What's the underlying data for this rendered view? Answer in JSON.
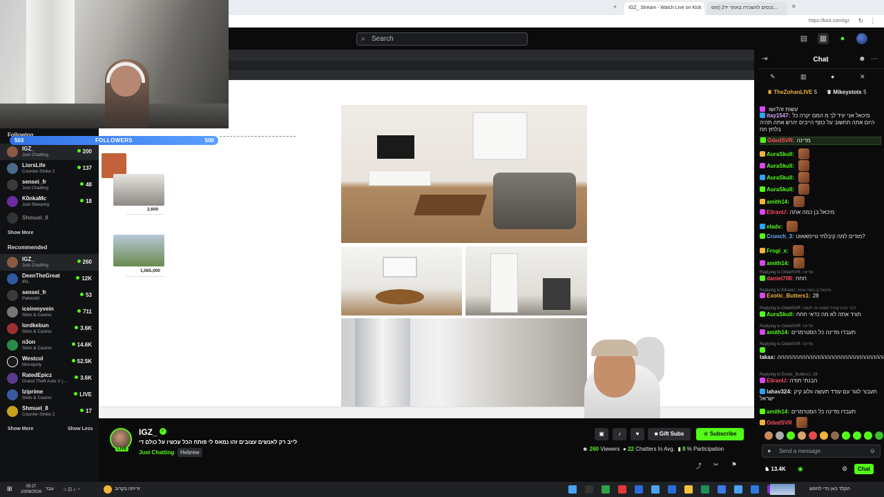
{
  "browser": {
    "tabs": [
      "IGZ_ Stream - Watch Live on Kick",
      "נכסים להשכרה באתר יד2 (פוס..."
    ],
    "url": "https://kick.com/igz"
  },
  "topnav": {
    "search_placeholder": "Search"
  },
  "followers_bar": {
    "left": "503",
    "label": "FOLLOWERS",
    "right": "500"
  },
  "sidebar": {
    "following_label": "Following",
    "following": [
      {
        "name": "IGZ_",
        "category": "Just Chatting",
        "count": "200"
      },
      {
        "name": "LiorsLife",
        "category": "Counter-Strike 2",
        "count": "137"
      },
      {
        "name": "sensei_fr",
        "category": "Just Chatting",
        "count": "48"
      },
      {
        "name": "K0nkaMc",
        "category": "Just Sleeping",
        "count": "18"
      },
      {
        "name": "Shmuel_8",
        "category": "",
        "count": ""
      }
    ],
    "show_more": "Show More",
    "recommended_label": "Recommended",
    "recommended": [
      {
        "name": "IGZ_",
        "category": "Just Chatting",
        "count": "260"
      },
      {
        "name": "DeenTheGreat",
        "category": "IRL",
        "count": "12K"
      },
      {
        "name": "sensei_fr",
        "category": "Palworld",
        "count": "53"
      },
      {
        "name": "iceinmyvein",
        "category": "Slots & Casino",
        "count": "711"
      },
      {
        "name": "lordkebun",
        "category": "Slots & Casino",
        "count": "3.6K"
      },
      {
        "name": "n3on",
        "category": "Slots & Casino",
        "count": "14.6K"
      },
      {
        "name": "Westcol",
        "category": "Monopoly",
        "count": "52.5K"
      },
      {
        "name": "RatedEpicz",
        "category": "Grand Theft Auto V (...",
        "count": "3.6K"
      },
      {
        "name": "Iziprime",
        "category": "Slots & Casino",
        "count": "LIVE"
      },
      {
        "name": "Shmuel_8",
        "category": "Counter-Strike 2",
        "count": "17"
      }
    ],
    "show_more_bottom": "Show More",
    "show_less": "Show Less"
  },
  "stream": {
    "listing_prices": [
      "2,600",
      "1,065,000"
    ]
  },
  "chat": {
    "title": "Chat",
    "pinned": [
      {
        "name": "TheZohanLIVE",
        "count": "5"
      },
      {
        "name": "Mikeystots",
        "count": "5"
      }
    ],
    "messages": [
      {
        "user": "",
        "color": "#e7e7e7",
        "text": "עשות זה?ושו"
      },
      {
        "user": "itay1547:",
        "color": "#d9a9ff",
        "text": "מיכאל אני יגיד לך מ המם יקרה כל היום אתה תחשוב על כסף הייבים יהרש אתה תהיה בלחץ חח"
      },
      {
        "user": "OdedSVR:",
        "color": "#ff4f5e",
        "text": "מדינה"
      },
      {
        "user": "AuraSkull:",
        "color": "#53fc18",
        "text": ""
      },
      {
        "user": "AuraSkull:",
        "color": "#53fc18",
        "text": ""
      },
      {
        "user": "AuraSkull:",
        "color": "#53fc18",
        "text": ""
      },
      {
        "user": "AuraSkull:",
        "color": "#53fc18",
        "text": ""
      },
      {
        "user": "amith14:",
        "color": "#53fc18",
        "text": ""
      },
      {
        "user": "EliranU:",
        "color": "#ff4f5e",
        "text": "מיכאל בן כמה אתה"
      },
      {
        "user": "eladx:",
        "color": "#53fc18",
        "text": ""
      },
      {
        "user": "Crunch_3:",
        "color": "#6fb1ff",
        "text": "מודים למה קיבלתי טיימאאוט?"
      },
      {
        "user": "Frogi_x:",
        "color": "#53fc18",
        "text": ""
      },
      {
        "user": "amith14:",
        "color": "#53fc18",
        "text": ""
      },
      {
        "user": "daniel708:",
        "color": "#ff4f5e",
        "text": "חחח"
      },
      {
        "user": "Exotic_Butters1:",
        "color": "#f2b23d",
        "text": "28"
      },
      {
        "user": "AuraSkull:",
        "color": "#53fc18",
        "text": "תגיד אתה לא מה כדאי חחח"
      },
      {
        "user": "amith14:",
        "color": "#53fc18",
        "text": "תעבדו מדינה כל הסטרמרים"
      },
      {
        "user": "lakax:",
        "color": "#e7e7e7",
        "text": "ההההההההההההההההההההההההההההההההההההההה"
      },
      {
        "user": "EliranU:",
        "color": "#ff4f5e",
        "text": "הבנתי תודה"
      },
      {
        "user": "lahav324:",
        "color": "#e7e7e7",
        "text": "תעבור לגור עם עודד תעשה וולוג קיק ישראל"
      },
      {
        "user": "amith14:",
        "color": "#53fc18",
        "text": "תעבדו מדינה כל הסטרמרים"
      },
      {
        "user": "OdedSVR",
        "color": "#ff4f5e",
        "text": ""
      }
    ],
    "replies": [
      "Replying to OdedSVR: מדינה",
      "Replying to EliranU: מיכאל בן כמה אתה",
      "Replying to OdedSVR: דבר הכה קנהל לשעה זה לעשה",
      "Replying to OdedSVR: מדינה",
      "Replying to OdedSVR: מדינה",
      "Replying to Exotic_Butters1: 28"
    ],
    "send_placeholder": "Send a message",
    "footer_count": "13.4K",
    "chat_button": "Chat"
  },
  "info": {
    "name": "IGZ_",
    "live": "LIVE",
    "title": "לייב רק לאנשים עצובים זהו נמאס לי פותח הכל עכשיו על כולם די",
    "category": "Just Chatting",
    "tag": "Hebrew",
    "gift": "Gift Subs",
    "subscribe": "Subscribe",
    "viewers": "260",
    "viewers_label": "Viewers",
    "chatters": "22",
    "chatters_label": "Chatters In Avg.",
    "participation": "8",
    "participation_label": "% Participation"
  },
  "os": {
    "time": "05:27",
    "date": "20/08/2026",
    "lang": "עבר",
    "weather": "זריחה בקרוב",
    "search_text": "הקלד כאן כדי לחפש"
  },
  "colors": {
    "accent": "#53fc18",
    "bg": "#0b0b0c"
  }
}
